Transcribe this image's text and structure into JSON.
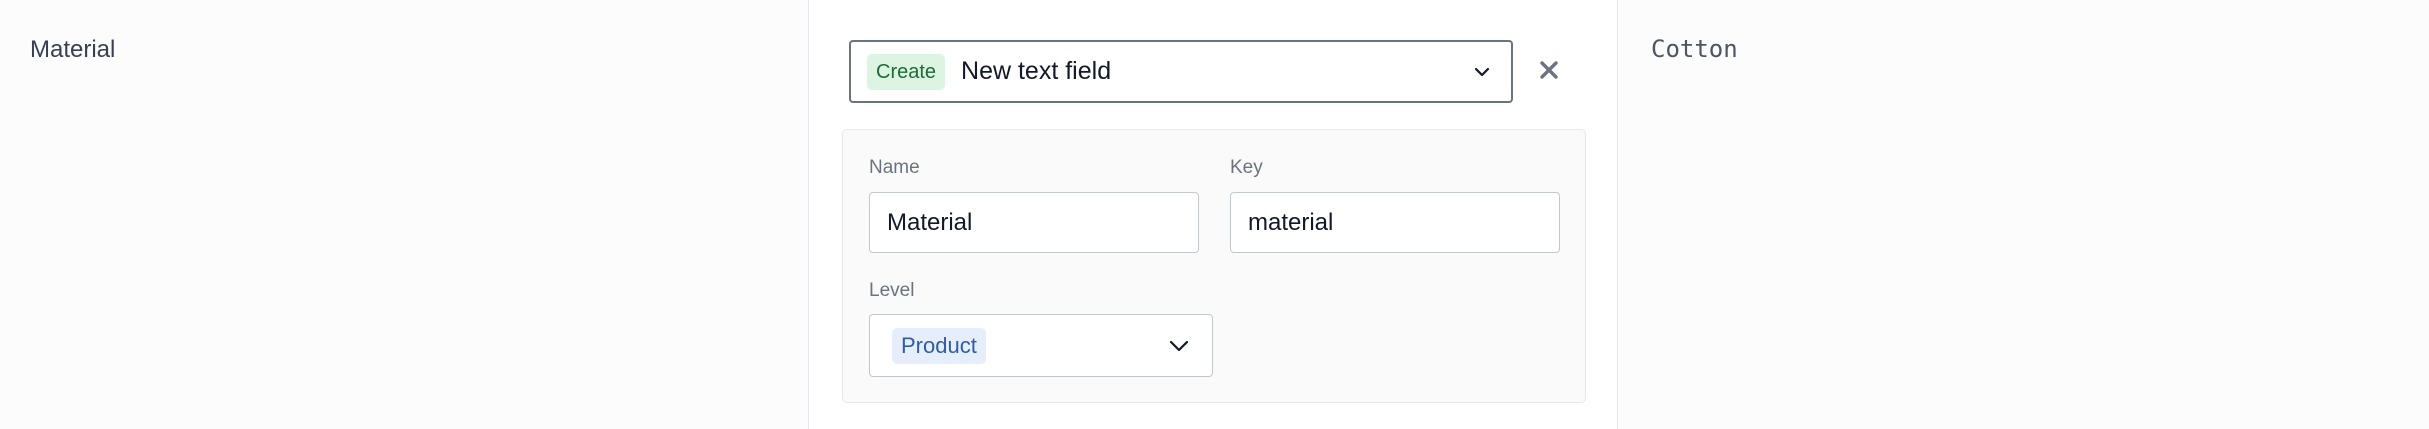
{
  "row": {
    "field_label": "Material",
    "mapping": {
      "badge": "Create",
      "value": "New text field",
      "chevron_icon": "chevron-down-icon",
      "clear_icon": "close-icon"
    },
    "form": {
      "name_label": "Name",
      "name_value": "Material",
      "key_label": "Key",
      "key_value": "material",
      "level_label": "Level",
      "level_value": "Product",
      "level_chevron_icon": "chevron-down-icon"
    },
    "preview_value": "Cotton"
  },
  "colors": {
    "create_badge_bg": "#dcf4e2",
    "create_badge_text": "#1f6b35",
    "product_badge_bg": "#e6eefb",
    "product_badge_text": "#2f5ea8"
  }
}
